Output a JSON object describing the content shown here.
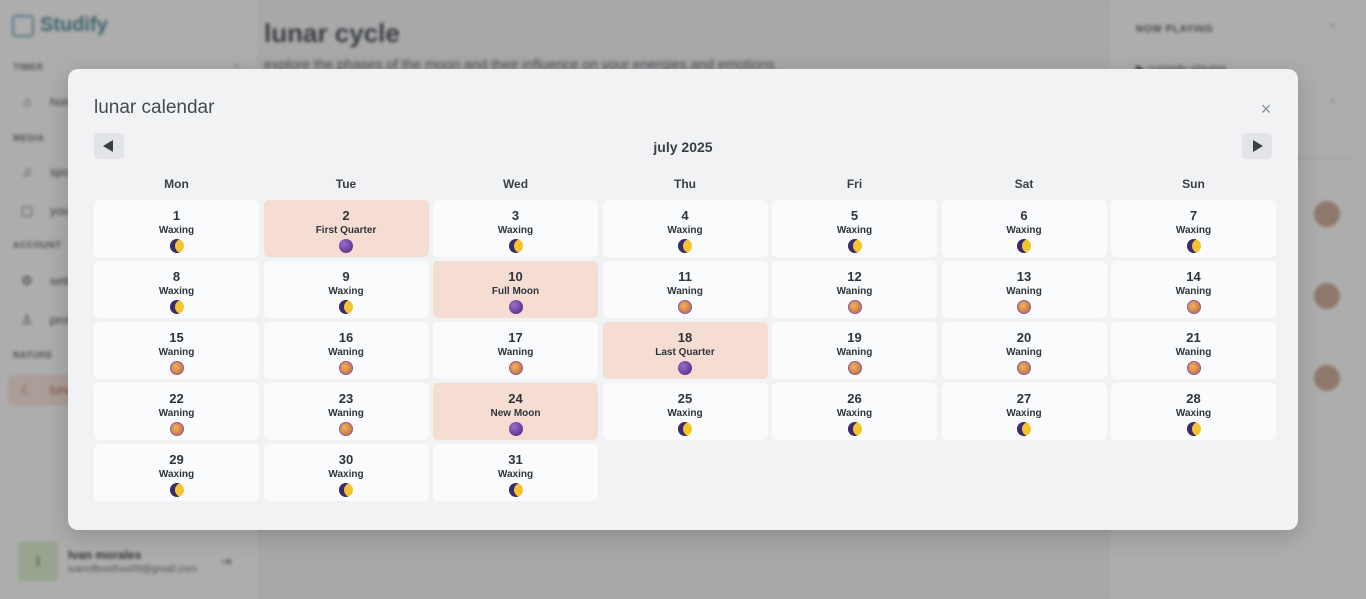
{
  "app": {
    "brand": "Studify",
    "sidebar": {
      "sections": [
        {
          "label": "TIMER"
        },
        {
          "label": "MEDIA"
        },
        {
          "label": "ACCOUNT"
        },
        {
          "label": "NATURE"
        }
      ],
      "items": [
        {
          "label": "home",
          "icon": "home-icon"
        },
        {
          "label": "spotify",
          "icon": "music-icon"
        },
        {
          "label": "youtube",
          "icon": "video-icon"
        },
        {
          "label": "settings",
          "icon": "gear-icon"
        },
        {
          "label": "profile",
          "icon": "person-icon"
        },
        {
          "label": "lunar cycle",
          "icon": "moon-icon",
          "active": true
        }
      ],
      "user": {
        "initial": "I",
        "name": "Ivan morales",
        "email": "ivanrdbosthos09@gmail.com"
      }
    },
    "main": {
      "title": "lunar cycle",
      "subtitle": "explore the phases of the moon and their influence on your energies and emotions"
    },
    "right_panel": {
      "now_playing_label": "NOW PLAYING",
      "track": "curiosity playing"
    }
  },
  "modal": {
    "title": "lunar calendar",
    "close_label": "×",
    "month_label": "july 2025",
    "prev_icon": "chevron-left-icon",
    "next_icon": "chevron-right-icon",
    "weekdays": [
      "Mon",
      "Tue",
      "Wed",
      "Thu",
      "Fri",
      "Sat",
      "Sun"
    ],
    "days": [
      {
        "day": "1",
        "phase": "Waxing",
        "type": "waxing"
      },
      {
        "day": "2",
        "phase": "First Quarter",
        "type": "quarter",
        "key": true
      },
      {
        "day": "3",
        "phase": "Waxing",
        "type": "waxing"
      },
      {
        "day": "4",
        "phase": "Waxing",
        "type": "waxing"
      },
      {
        "day": "5",
        "phase": "Waxing",
        "type": "waxing"
      },
      {
        "day": "6",
        "phase": "Waxing",
        "type": "waxing"
      },
      {
        "day": "7",
        "phase": "Waxing",
        "type": "waxing"
      },
      {
        "day": "8",
        "phase": "Waxing",
        "type": "waxing"
      },
      {
        "day": "9",
        "phase": "Waxing",
        "type": "waxing"
      },
      {
        "day": "10",
        "phase": "Full Moon",
        "type": "full",
        "key": true
      },
      {
        "day": "11",
        "phase": "Waning",
        "type": "waning"
      },
      {
        "day": "12",
        "phase": "Waning",
        "type": "waning"
      },
      {
        "day": "13",
        "phase": "Waning",
        "type": "waning"
      },
      {
        "day": "14",
        "phase": "Waning",
        "type": "waning"
      },
      {
        "day": "15",
        "phase": "Waning",
        "type": "waning"
      },
      {
        "day": "16",
        "phase": "Waning",
        "type": "waning"
      },
      {
        "day": "17",
        "phase": "Waning",
        "type": "waning"
      },
      {
        "day": "18",
        "phase": "Last Quarter",
        "type": "quarter",
        "key": true
      },
      {
        "day": "19",
        "phase": "Waning",
        "type": "waning"
      },
      {
        "day": "20",
        "phase": "Waning",
        "type": "waning"
      },
      {
        "day": "21",
        "phase": "Waning",
        "type": "waning"
      },
      {
        "day": "22",
        "phase": "Waning",
        "type": "waning"
      },
      {
        "day": "23",
        "phase": "Waning",
        "type": "waning"
      },
      {
        "day": "24",
        "phase": "New Moon",
        "type": "new",
        "key": true
      },
      {
        "day": "25",
        "phase": "Waxing",
        "type": "waxing"
      },
      {
        "day": "26",
        "phase": "Waxing",
        "type": "waxing"
      },
      {
        "day": "27",
        "phase": "Waxing",
        "type": "waxing"
      },
      {
        "day": "28",
        "phase": "Waxing",
        "type": "waxing"
      },
      {
        "day": "29",
        "phase": "Waxing",
        "type": "waxing"
      },
      {
        "day": "30",
        "phase": "Waxing",
        "type": "waxing"
      },
      {
        "day": "31",
        "phase": "Waxing",
        "type": "waxing"
      }
    ],
    "colors": {
      "key_phase_bg": "#f5ddd3",
      "cell_bg": "#fafbfc",
      "modal_bg": "#f1f2f4"
    }
  }
}
